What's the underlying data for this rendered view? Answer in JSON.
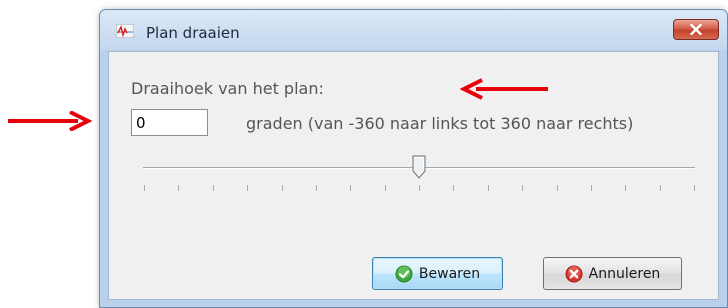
{
  "dialog": {
    "title": "Plan draaien",
    "heading": "Draaihoek van het plan:",
    "angle_input": {
      "value": "0"
    },
    "unit_label": "graden (van -360 naar links tot 360 naar rechts)",
    "slider": {
      "value": 0,
      "min": -360,
      "max": 360,
      "tick_count": 17
    },
    "buttons": {
      "save_label": "Bewaren",
      "cancel_label": "Annuleren"
    }
  },
  "icons": {
    "app": "app-icon",
    "close": "close-icon",
    "save": "check-circle-icon",
    "cancel": "x-circle-icon"
  },
  "colors": {
    "annotation_arrow": "#e8000b",
    "close_button": "#c9452e",
    "save_icon": "#3daa3d",
    "cancel_icon": "#d9342b"
  }
}
